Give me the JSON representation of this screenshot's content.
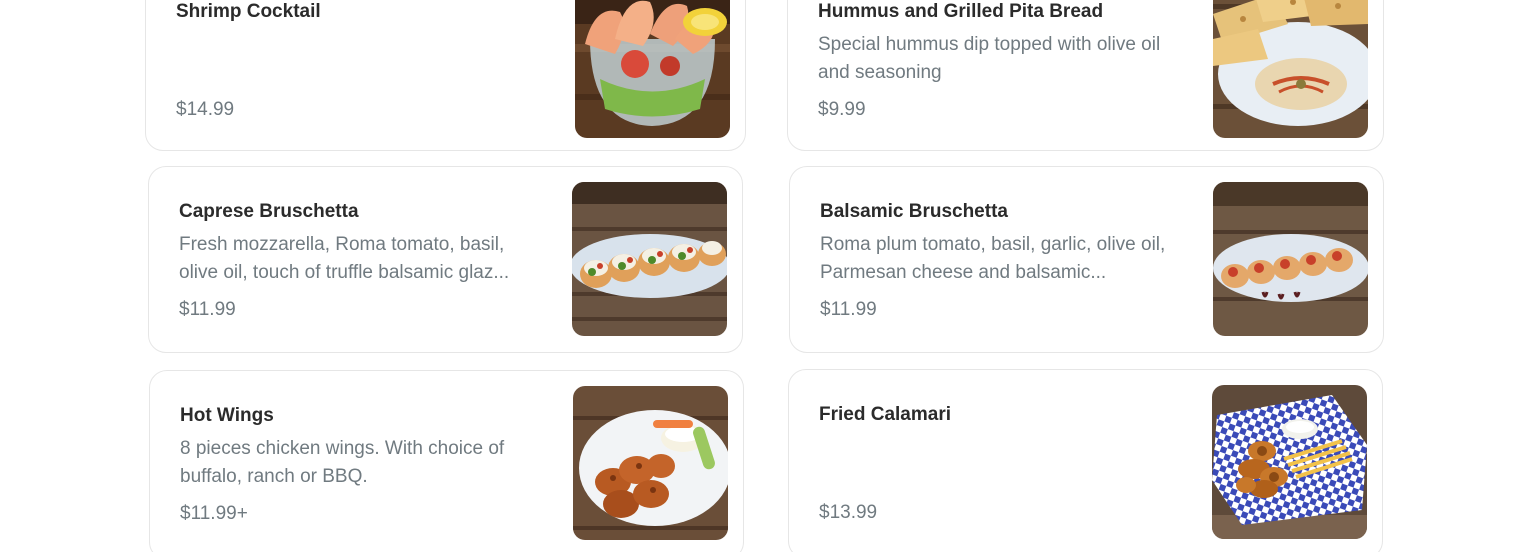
{
  "menu": {
    "items": [
      {
        "name": "Shrimp Cocktail",
        "description": "",
        "price": "$14.99",
        "image": "shrimp-cocktail-photo"
      },
      {
        "name": "Hummus and Grilled Pita Bread",
        "description": "Special hummus dip topped with olive oil and seasoning",
        "price": "$9.99",
        "image": "hummus-pita-photo"
      },
      {
        "name": "Caprese Bruschetta",
        "description": "Fresh mozzarella, Roma tomato, basil, olive oil, touch of truffle balsamic glaz...",
        "price": "$11.99",
        "image": "caprese-bruschetta-photo"
      },
      {
        "name": "Balsamic Bruschetta",
        "description": "Roma plum tomato, basil, garlic, olive oil, Parmesan cheese and balsamic...",
        "price": "$11.99",
        "image": "balsamic-bruschetta-photo"
      },
      {
        "name": "Hot Wings",
        "description": "8 pieces chicken wings. With choice of buffalo, ranch or BBQ.",
        "price": "$11.99+",
        "image": "hot-wings-photo"
      },
      {
        "name": "Fried Calamari",
        "description": "",
        "price": "$13.99",
        "image": "fried-calamari-photo"
      }
    ]
  },
  "colors": {
    "title": "#2b2b2b",
    "muted_text": "#707a80",
    "card_border": "#e6e6e6",
    "background": "#ffffff"
  }
}
